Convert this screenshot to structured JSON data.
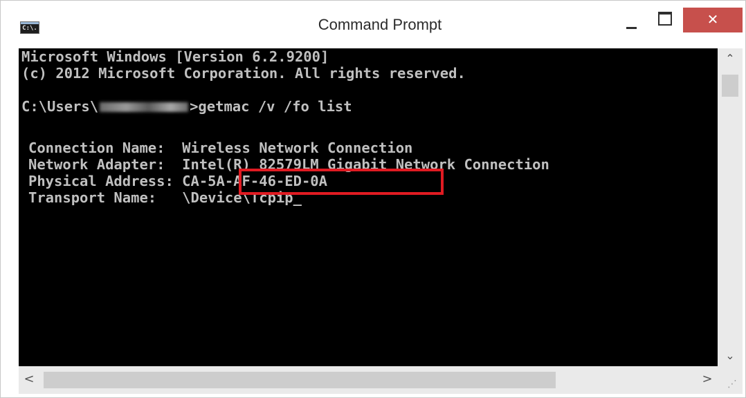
{
  "window": {
    "title": "Command Prompt",
    "icon_label": "C:\\.",
    "close_glyph": "✕"
  },
  "console": {
    "lines": [
      "Microsoft Windows [Version 6.2.9200]",
      "(c) 2012 Microsoft Corporation. All rights reserved.",
      "",
      "",
      "",
      "Connection Name:  Wireless Network Connection",
      "Network Adapter:  Intel(R) 82579LM Gigabit Network Connection",
      "Physical Address: CA-5A-AF-46-ED-0A",
      "Transport Name:   \\Device\\Tcpip_"
    ],
    "prompt_prefix": "C:\\Users\\",
    "prompt_suffix": ">getmac /v /fo list",
    "blurred_username": "redacted-username",
    "highlighted_value": "CA-5A-AF-46-ED-0A"
  },
  "scrollbars": {
    "up_glyph": "⌃",
    "down_glyph": "⌄",
    "left_glyph": "<",
    "right_glyph": ">"
  },
  "colors": {
    "console_bg": "#000000",
    "console_text": "#c0c0c0",
    "highlight_border": "#e01b22",
    "close_button": "#c7504c"
  }
}
